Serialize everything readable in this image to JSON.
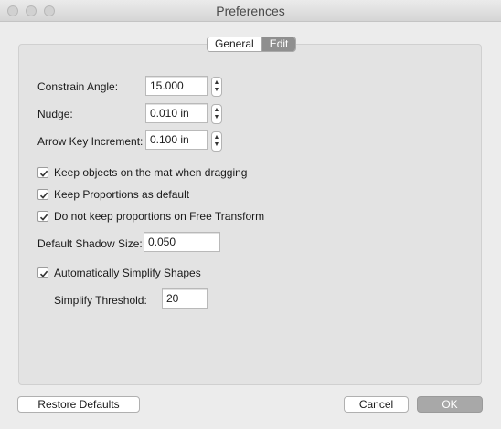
{
  "window": {
    "title": "Preferences"
  },
  "tabs": [
    {
      "label": "General",
      "selected": false
    },
    {
      "label": "Edit",
      "selected": true
    }
  ],
  "fields": {
    "constrain_angle": {
      "label": "Constrain Angle:",
      "value": "15.000"
    },
    "nudge": {
      "label": "Nudge:",
      "value": "0.010 in"
    },
    "arrow_key_increment": {
      "label": "Arrow Key Increment:",
      "value": "0.100 in"
    },
    "default_shadow_size": {
      "label": "Default Shadow Size:",
      "value": "0.050"
    },
    "simplify_threshold": {
      "label": "Simplify Threshold:",
      "value": "20"
    }
  },
  "checkboxes": [
    {
      "label": "Keep objects on the mat when dragging",
      "checked": true
    },
    {
      "label": "Keep Proportions as default",
      "checked": true
    },
    {
      "label": "Do not keep proportions on Free Transform",
      "checked": true
    },
    {
      "label": "Automatically Simplify Shapes",
      "checked": true
    }
  ],
  "buttons": {
    "restore_defaults": "Restore Defaults",
    "cancel": "Cancel",
    "ok": "OK"
  },
  "colors": {
    "selected_tab": "#8f8f8f",
    "ok_button": "#a8a8a8"
  }
}
